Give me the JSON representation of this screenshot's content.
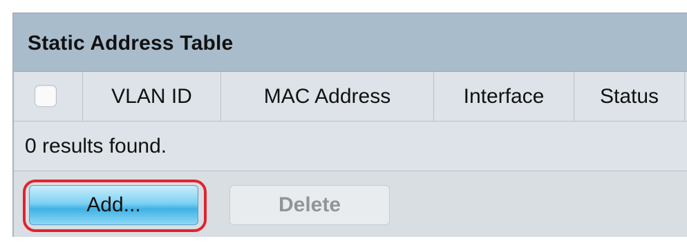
{
  "table": {
    "title": "Static Address Table",
    "columns": [
      "",
      "VLAN ID",
      "MAC Address",
      "Interface",
      "Status"
    ],
    "results_text": "0 results found.",
    "rows": []
  },
  "buttons": {
    "add_label": "Add...",
    "delete_label": "Delete"
  },
  "colors": {
    "title_bar": "#a9bccc",
    "highlight": "#e0242e",
    "add_button": "#3fb2e4"
  }
}
